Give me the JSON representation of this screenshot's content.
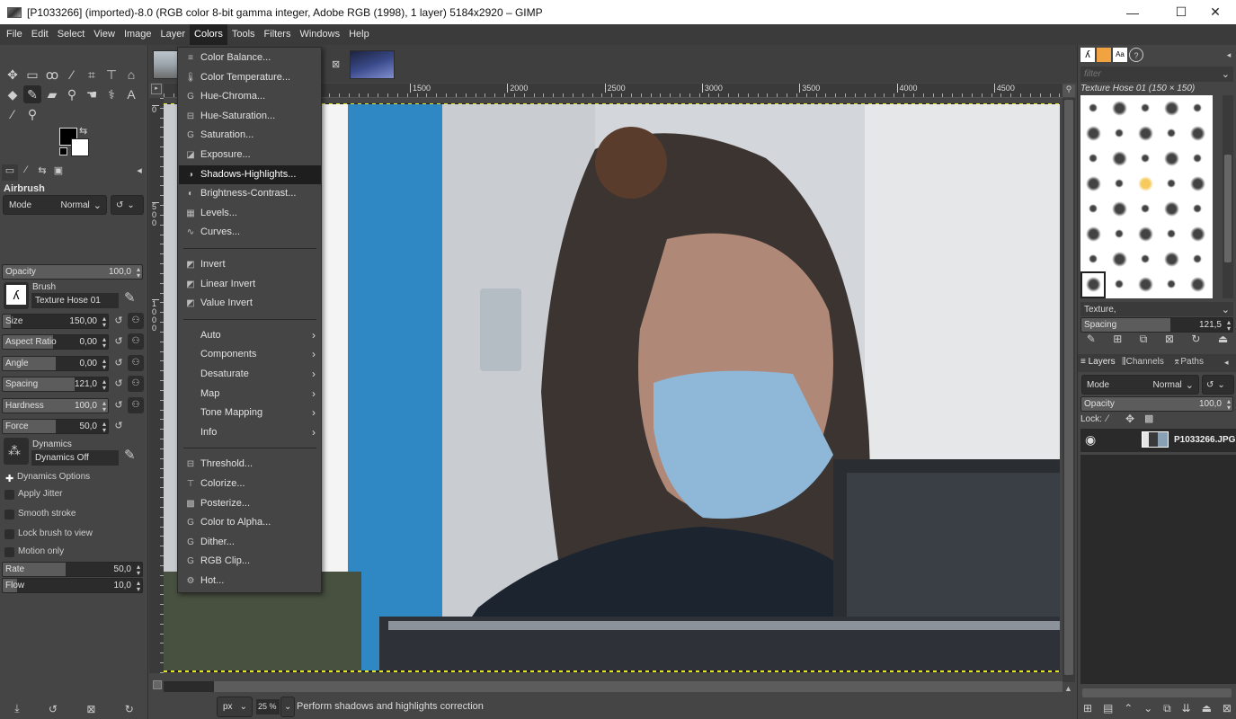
{
  "window": {
    "title": "[P1033266] (imported)-8.0 (RGB color 8-bit gamma integer, Adobe RGB (1998), 1 layer) 5184x2920 – GIMP",
    "minimize": "—",
    "maximize": "☐",
    "close": "✕"
  },
  "menubar": [
    "File",
    "Edit",
    "Select",
    "View",
    "Image",
    "Layer",
    "Colors",
    "Tools",
    "Filters",
    "Windows",
    "Help"
  ],
  "menubar_active": "Colors",
  "toolbox": {
    "tools": [
      {
        "name": "move-tool",
        "glyph": "✥"
      },
      {
        "name": "rect-select-tool",
        "glyph": "▭"
      },
      {
        "name": "free-select-tool",
        "glyph": "ꝏ"
      },
      {
        "name": "fuzzy-select-tool",
        "glyph": "⁄"
      },
      {
        "name": "crop-tool",
        "glyph": "⌗"
      },
      {
        "name": "unified-transform-tool",
        "glyph": "⊤"
      },
      {
        "name": "warp-transform-tool",
        "glyph": "⌂"
      },
      {
        "name": "bucket-fill-tool",
        "glyph": "◆"
      },
      {
        "name": "airbrush-tool",
        "glyph": "✎"
      },
      {
        "name": "eraser-tool",
        "glyph": "▰"
      },
      {
        "name": "clone-tool",
        "glyph": "⚲"
      },
      {
        "name": "smudge-tool",
        "glyph": "☚"
      },
      {
        "name": "paths-tool",
        "glyph": "⚕"
      },
      {
        "name": "text-tool",
        "glyph": "A"
      },
      {
        "name": "color-picker-tool",
        "glyph": "⁄"
      },
      {
        "name": "zoom-tool",
        "glyph": "⚲"
      }
    ],
    "fg_color": "#000000",
    "bg_color": "#ffffff",
    "swap_glyph": "⇆"
  },
  "tool_options": {
    "title": "Airbrush",
    "mode_label": "Mode",
    "mode_value": "Normal",
    "opacity": {
      "label": "Opacity",
      "value": "100,0",
      "fraction": 1.0
    },
    "brush_label": "Brush",
    "brush_name": "Texture Hose 01",
    "sliders": [
      {
        "label": "Size",
        "value": "150,00",
        "fraction": 0.08
      },
      {
        "label": "Aspect Ratio",
        "value": "0,00",
        "fraction": 0.48
      },
      {
        "label": "Angle",
        "value": "0,00",
        "fraction": 0.5
      },
      {
        "label": "Spacing",
        "value": "121,0",
        "fraction": 0.68
      },
      {
        "label": "Hardness",
        "value": "100,0",
        "fraction": 1.0
      },
      {
        "label": "Force",
        "value": "50,0",
        "fraction": 0.5
      }
    ],
    "dynamics_label": "Dynamics",
    "dynamics_name": "Dynamics Off",
    "dynamics_options": "Dynamics Options",
    "checkboxes": [
      {
        "label": "Apply Jitter",
        "checked": false
      },
      {
        "label": "Smooth stroke",
        "checked": false
      },
      {
        "label": "Lock brush to view",
        "checked": false
      },
      {
        "label": "Motion only",
        "checked": false
      }
    ],
    "rate": {
      "label": "Rate",
      "value": "50,0",
      "fraction": 0.45
    },
    "flow": {
      "label": "Flow",
      "value": "10,0",
      "fraction": 0.1
    }
  },
  "rulers": {
    "h_labels": [
      "1500",
      "2000",
      "2500",
      "3000",
      "3500",
      "4000",
      "4500"
    ],
    "v_labels": [
      "0",
      "500",
      "1000"
    ]
  },
  "colors_menu": {
    "items": [
      {
        "label": "Color Balance...",
        "icon": "≡",
        "type": "item"
      },
      {
        "label": "Color Temperature...",
        "icon": "🌡",
        "type": "item"
      },
      {
        "label": "Hue-Chroma...",
        "icon": "G",
        "type": "item"
      },
      {
        "label": "Hue-Saturation...",
        "icon": "⊟",
        "type": "item"
      },
      {
        "label": "Saturation...",
        "icon": "G",
        "type": "item"
      },
      {
        "label": "Exposure...",
        "icon": "◪",
        "type": "item"
      },
      {
        "label": "Shadows-Highlights...",
        "icon": "◑",
        "type": "item",
        "highlighted": true
      },
      {
        "label": "Brightness-Contrast...",
        "icon": "◐",
        "type": "item"
      },
      {
        "label": "Levels...",
        "icon": "▦",
        "type": "item"
      },
      {
        "label": "Curves...",
        "icon": "∿",
        "type": "item"
      },
      {
        "type": "separator"
      },
      {
        "label": "Invert",
        "icon": "◩",
        "type": "item"
      },
      {
        "label": "Linear Invert",
        "icon": "◩",
        "type": "item"
      },
      {
        "label": "Value Invert",
        "icon": "◩",
        "type": "item"
      },
      {
        "type": "separator"
      },
      {
        "label": "Auto",
        "type": "submenu"
      },
      {
        "label": "Components",
        "type": "submenu"
      },
      {
        "label": "Desaturate",
        "type": "submenu"
      },
      {
        "label": "Map",
        "type": "submenu"
      },
      {
        "label": "Tone Mapping",
        "type": "submenu"
      },
      {
        "label": "Info",
        "type": "submenu"
      },
      {
        "type": "separator"
      },
      {
        "label": "Threshold...",
        "icon": "⊟",
        "type": "item"
      },
      {
        "label": "Colorize...",
        "icon": "⊤",
        "type": "item"
      },
      {
        "label": "Posterize...",
        "icon": "▩",
        "type": "item"
      },
      {
        "label": "Color to Alpha...",
        "icon": "G",
        "type": "item"
      },
      {
        "label": "Dither...",
        "icon": "G",
        "type": "item"
      },
      {
        "label": "RGB Clip...",
        "icon": "G",
        "type": "item"
      },
      {
        "label": "Hot...",
        "icon": "⚙",
        "type": "item"
      }
    ]
  },
  "statusbar": {
    "unit": "px",
    "zoom": "25 %",
    "message": "Perform shadows and highlights correction"
  },
  "brushes_panel": {
    "filter_placeholder": "filter",
    "brush_title": "Texture Hose 01 (150 × 150)",
    "tag_value": "Texture,",
    "spacing_label": "Spacing",
    "spacing_value": "121,5",
    "spacing_fraction": 0.59
  },
  "layers_panel": {
    "tabs": [
      "Layers",
      "Channels",
      "Paths"
    ],
    "mode_label": "Mode",
    "mode_value": "Normal",
    "opacity_label": "Opacity",
    "opacity_value": "100,0",
    "lock_label": "Lock:",
    "layers": [
      {
        "name": "P1033266.JPG",
        "visible": true
      }
    ]
  }
}
